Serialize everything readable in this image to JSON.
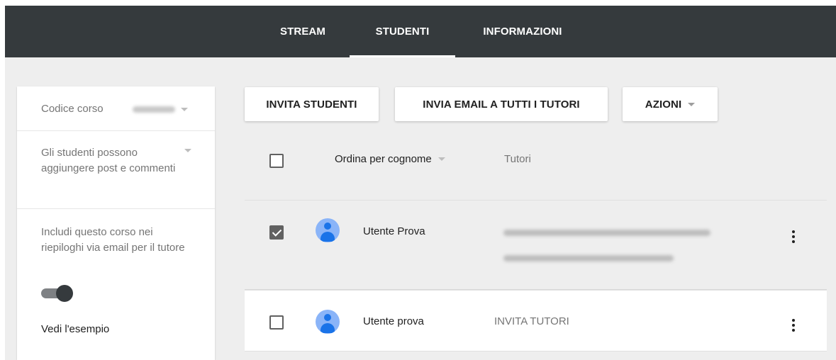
{
  "tabs": [
    {
      "label": "STREAM",
      "active": false
    },
    {
      "label": "STUDENTI",
      "active": true
    },
    {
      "label": "INFORMAZIONI",
      "active": false
    }
  ],
  "sidebar": {
    "course_code_label": "Codice corso",
    "posting_setting": "Gli studenti possono aggiungere post e commenti",
    "email_summary_label": "Includi questo corso nei riepiloghi via email per il tutore",
    "email_summary_enabled": true,
    "example_link": "Vedi l'esempio"
  },
  "toolbar": {
    "invite_students": "INVITA STUDENTI",
    "email_all_guardians": "INVIA EMAIL A TUTTI I TUTORI",
    "actions": "AZIONI"
  },
  "list_header": {
    "sort_label": "Ordina per cognome",
    "guardians_column": "Tutori"
  },
  "students": [
    {
      "name": "Utente Prova",
      "selected": true,
      "guardians": "blurred"
    },
    {
      "name": "Utente prova",
      "selected": false,
      "guardians_action": "INVITA TUTORI"
    }
  ],
  "colors": {
    "topbar": "#353a3d",
    "background": "#eeeeee",
    "avatar": "#8ab4f8",
    "avatar_fg": "#1a73e8"
  },
  "icons": [
    "dropdown-caret-icon",
    "toggle-switch",
    "checkbox-icon",
    "avatar-icon",
    "more-vertical-icon"
  ]
}
